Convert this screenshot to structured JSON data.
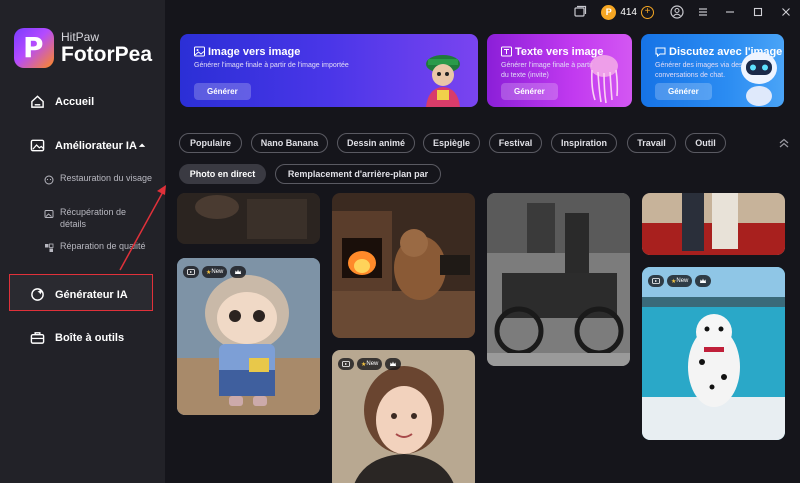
{
  "app": {
    "brand_small": "HitPaw",
    "brand_big": "FotorPea"
  },
  "titlebar": {
    "coins": "414",
    "coin_symbol": "P"
  },
  "sidebar": {
    "home": "Accueil",
    "enhancer": "Améliorateur IA",
    "enhancer_caret": "⏶",
    "sub_items": [
      "Restauration du visage",
      "Récupération de détails",
      "Réparation de qualité"
    ],
    "generator": "Générateur IA",
    "toolbox": "Boîte à outils"
  },
  "banners": [
    {
      "title": "Image vers image",
      "desc": "Générer l'image finale à partir de l'image importée",
      "button": "Générer"
    },
    {
      "title": "Texte vers image",
      "desc_line1": "Générer l'image finale à partir",
      "desc_line2": "du texte (invite)",
      "button": "Générer"
    },
    {
      "title": "Discutez avec l'image",
      "desc_line1": "Générer des images via des",
      "desc_line2": "conversations de chat.",
      "button": "Générer"
    }
  ],
  "chips_row1": [
    "Populaire",
    "Nano Banana",
    "Dessin animé",
    "Espiègle",
    "Festival",
    "Inspiration",
    "Travail",
    "Outil"
  ],
  "chips_row2": [
    "Photo en direct",
    "Remplacement d'arrière-plan par"
  ],
  "gallery": {
    "new_label": "New"
  },
  "colors": {
    "accent_red": "#e0313a",
    "sidebar_bg": "#222228",
    "page_bg": "#15151b",
    "coin": "#f5a623"
  }
}
